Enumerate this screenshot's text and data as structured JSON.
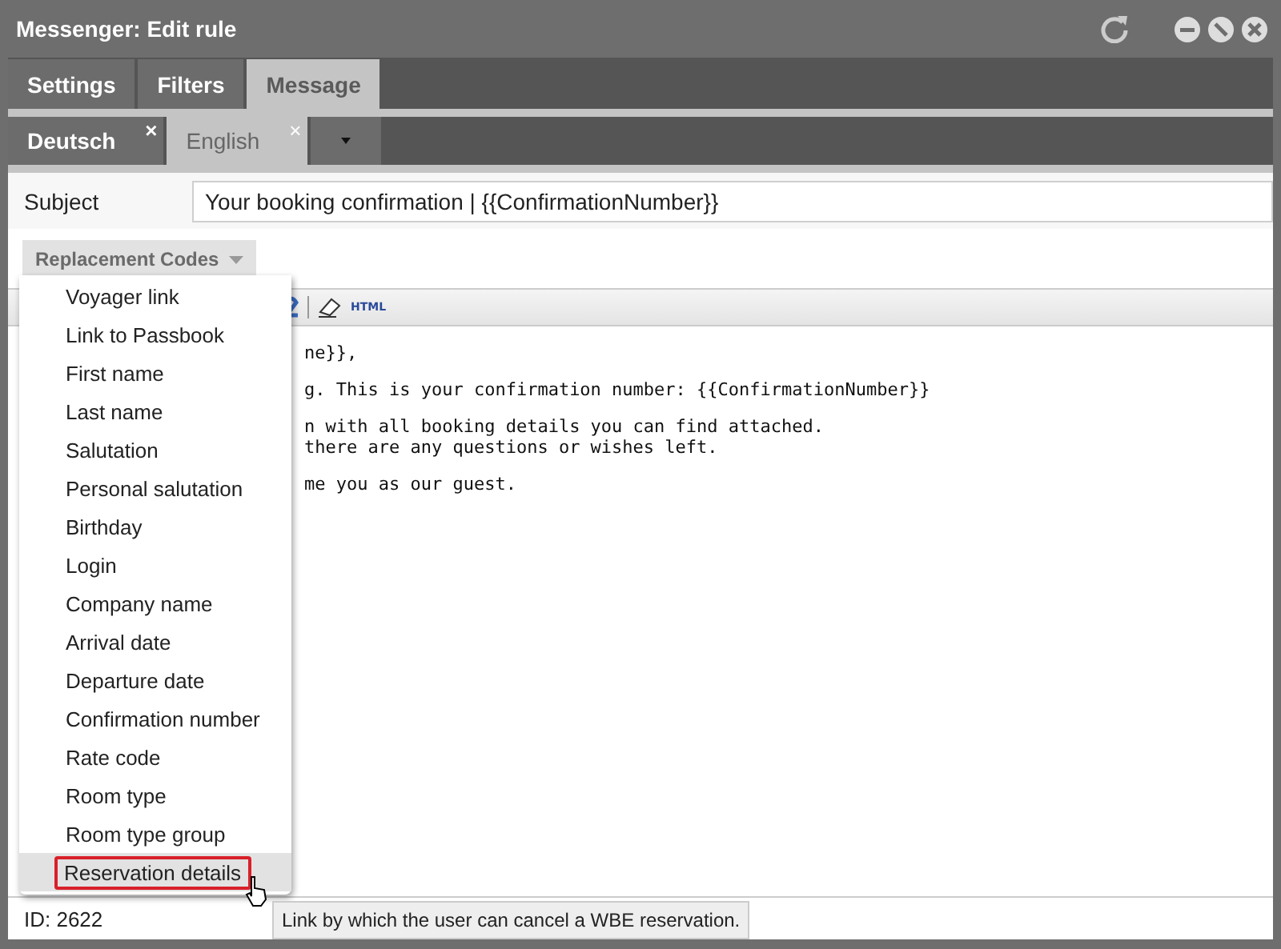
{
  "window": {
    "title": "Messenger: Edit rule"
  },
  "tabs": [
    {
      "label": "Settings",
      "selected": false
    },
    {
      "label": "Filters",
      "selected": false
    },
    {
      "label": "Message",
      "selected": true
    }
  ],
  "language_tabs": [
    {
      "label": "Deutsch",
      "selected": false
    },
    {
      "label": "English",
      "selected": true
    }
  ],
  "close_glyph": "×",
  "subject": {
    "label": "Subject",
    "value": "Your booking confirmation | {{ConfirmationNumber}}"
  },
  "replacement_codes": {
    "label": "Replacement Codes",
    "expanded": true,
    "items": [
      {
        "label": "Voyager link",
        "selected": false
      },
      {
        "label": "Link to Passbook",
        "selected": false
      },
      {
        "label": "First name",
        "selected": false
      },
      {
        "label": "Last name",
        "selected": false
      },
      {
        "label": "Salutation",
        "selected": false
      },
      {
        "label": "Personal salutation",
        "selected": false
      },
      {
        "label": "Birthday",
        "selected": false
      },
      {
        "label": "Login",
        "selected": false
      },
      {
        "label": "Company name",
        "selected": false
      },
      {
        "label": "Arrival date",
        "selected": false
      },
      {
        "label": "Departure date",
        "selected": false
      },
      {
        "label": "Confirmation number",
        "selected": false
      },
      {
        "label": "Rate code",
        "selected": false
      },
      {
        "label": "Room type",
        "selected": false
      },
      {
        "label": "Room type group",
        "selected": false
      },
      {
        "label": "Reservation details",
        "selected": true
      }
    ]
  },
  "editor": {
    "html_button": "HTML",
    "paragraphs": [
      [
        "ne}},"
      ],
      [
        "g. This is your confirmation number: {{ConfirmationNumber}}"
      ],
      [
        "n with all booking details you can find attached.",
        "there are any questions or wishes left."
      ],
      [
        "me you as our guest."
      ]
    ]
  },
  "tooltip": "Link by which the user can cancel a WBE reservation.",
  "footer": {
    "id": "ID: 2622"
  }
}
